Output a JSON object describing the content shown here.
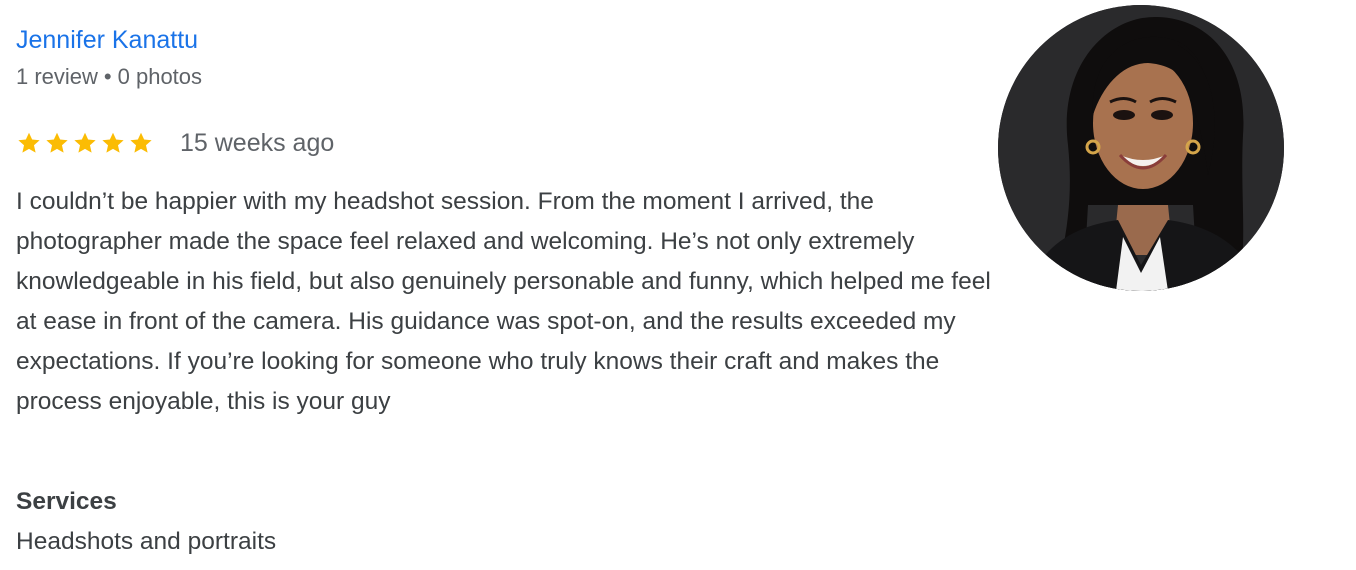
{
  "review": {
    "reviewer_name": "Jennifer Kanattu",
    "review_count": "1 review",
    "meta_separator": "•",
    "photo_count": "0 photos",
    "rating": 5,
    "rating_max": 5,
    "star_color": "#fbbc04",
    "time_ago": "15 weeks ago",
    "text": "I couldn’t be happier with my headshot session. From the moment I arrived, the photographer made the space feel relaxed and welcoming. He’s not only extremely knowledgeable in his field, but also genuinely personable and funny, which helped me feel at ease in front of the camera. His guidance was spot-on, and the results exceeded my expectations. If you’re looking for someone who truly knows their craft and makes the process enjoyable, this is your guy",
    "services_heading": "Services",
    "services_value": "Headshots and portraits"
  },
  "colors": {
    "link": "#1a73e8",
    "secondary_text": "#5f6368",
    "body_text": "#3c4043"
  }
}
